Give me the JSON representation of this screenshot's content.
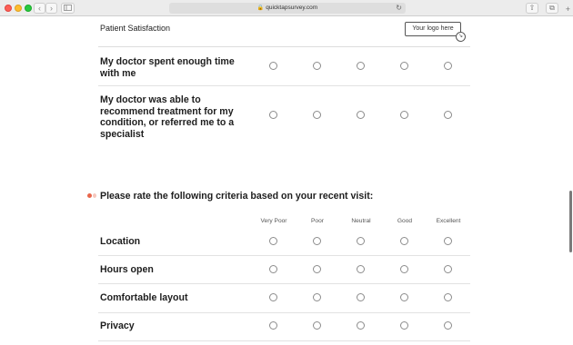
{
  "browser": {
    "url": "quicktapsurvey.com"
  },
  "survey": {
    "title": "Patient Satisfaction",
    "logo_placeholder": "Your logo here"
  },
  "previous_questions": [
    {
      "label_lines": [
        "My doctor spent enough time",
        "with me"
      ]
    },
    {
      "label_lines": [
        "My doctor was able to",
        "recommend treatment for my",
        "condition, or referred me to a",
        "specialist"
      ]
    }
  ],
  "matrix_question": {
    "prompt": "Please rate the following criteria based on your recent visit:",
    "columns": [
      "Very Poor",
      "Poor",
      "Neutral",
      "Good",
      "Excellent"
    ],
    "rows": [
      "Location",
      "Hours open",
      "Comfortable layout",
      "Privacy"
    ]
  },
  "colors": {
    "required_marker": "#e8664b",
    "radio_border": "#8c8c8c",
    "divider": "#e2e2e2"
  }
}
